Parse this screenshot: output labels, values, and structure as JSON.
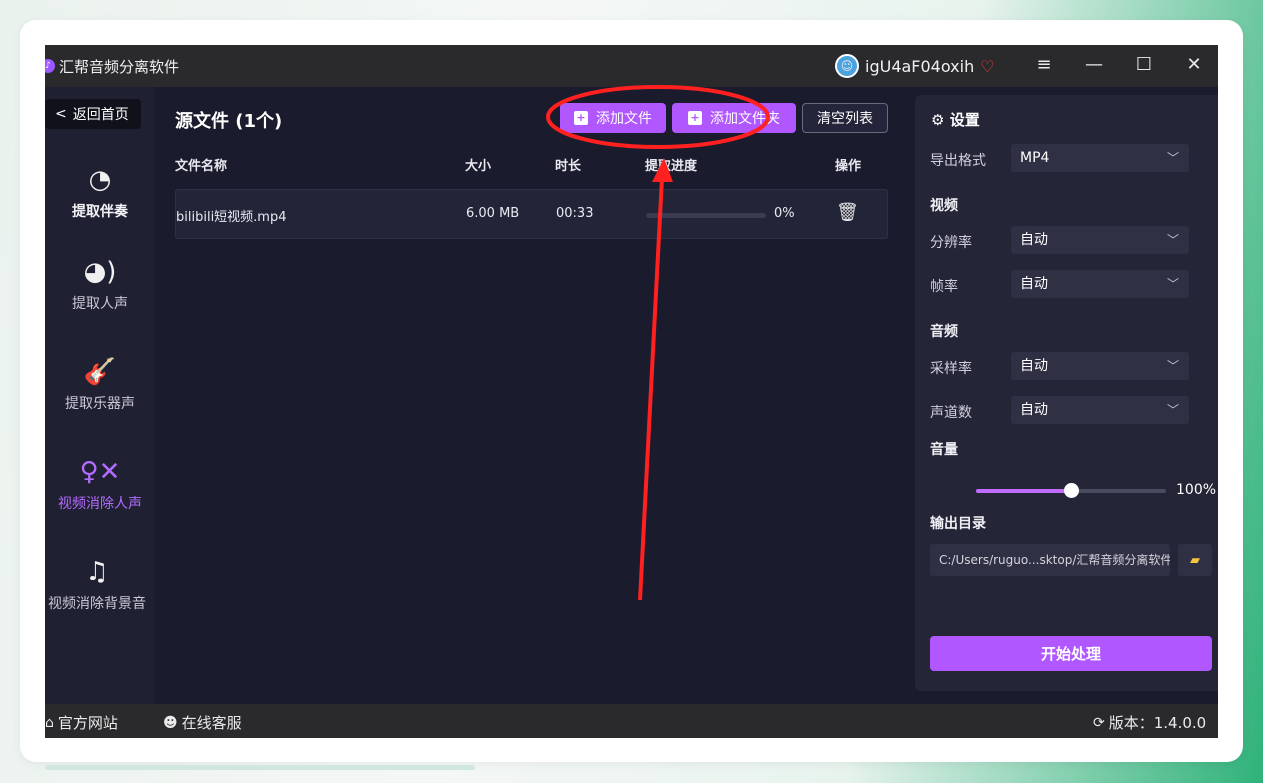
{
  "window": {
    "title": "汇帮音频分离软件",
    "username": "igU4aF04oxih",
    "menu_icon": "≡",
    "min_icon": "—",
    "max_icon": "☐",
    "close_icon": "✕"
  },
  "sidebar": {
    "back_label": "返回首页",
    "items": [
      {
        "label": "提取伴奏",
        "icon": "music-note-icon"
      },
      {
        "label": "提取人声",
        "icon": "voice-icon"
      },
      {
        "label": "提取乐器声",
        "icon": "guitar-icon"
      },
      {
        "label": "视频消除人声",
        "icon": "remove-person-icon"
      },
      {
        "label": "视频消除背景音",
        "icon": "mute-music-icon"
      }
    ]
  },
  "main": {
    "title": "源文件 (1个)",
    "buttons": {
      "add_file": "添加文件",
      "add_folder": "添加文件夹",
      "clear_list": "清空列表"
    },
    "columns": {
      "name": "文件名称",
      "size": "大小",
      "duration": "时长",
      "progress": "提取进度",
      "action": "操作"
    },
    "rows": [
      {
        "name": "bilibili短视频.mp4",
        "size": "6.00 MB",
        "duration": "00:33",
        "progress_text": "0%",
        "progress": 0
      }
    ]
  },
  "settings": {
    "title": "设置",
    "export_format_label": "导出格式",
    "export_format_value": "MP4",
    "video_section": "视频",
    "resolution_label": "分辨率",
    "resolution_value": "自动",
    "framerate_label": "帧率",
    "framerate_value": "自动",
    "audio_section": "音频",
    "samplerate_label": "采样率",
    "samplerate_value": "自动",
    "channels_label": "声道数",
    "channels_value": "自动",
    "volume_label": "音量",
    "volume_value": "100%",
    "volume_level": 0.5,
    "output_dir_label": "输出目录",
    "output_dir_value": "C:/Users/ruguo...sktop/汇帮音频分离软件",
    "start_button": "开始处理"
  },
  "footer": {
    "website": "官方网站",
    "support": "在线客服",
    "version": "版本：1.4.0.0"
  },
  "colors": {
    "accent": "#b057ff",
    "annotation": "#ff2020",
    "app_bg": "#1a1b2c"
  }
}
